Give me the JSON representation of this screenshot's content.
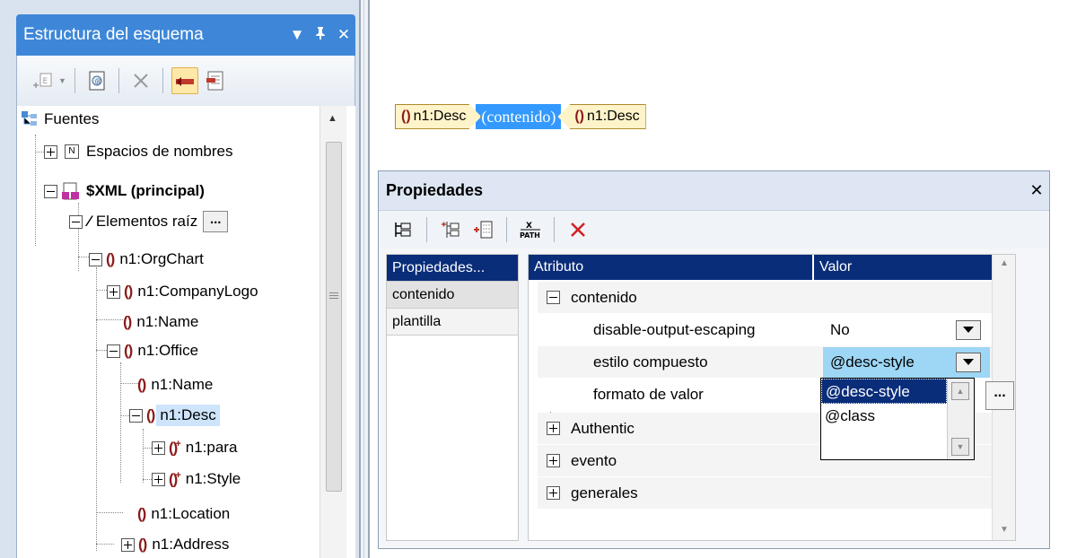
{
  "schema_panel": {
    "title": "Estructura del esquema",
    "title_buttons": [
      "▼",
      "⊥",
      "✕"
    ],
    "tree": {
      "fuentes": "Fuentes",
      "namespaces": "Espacios de nombres",
      "xml_principal": "$XML (principal)",
      "root_elements": "Elementos raíz",
      "root_dots": "...",
      "orgchart": "n1:OrgChart",
      "companylogo": "n1:CompanyLogo",
      "name1": "n1:Name",
      "office": "n1:Office",
      "name2": "n1:Name",
      "desc": "n1:Desc",
      "para": "n1:para",
      "style": "n1:Style",
      "location": "n1:Location",
      "address": "n1:Address"
    }
  },
  "design_view": {
    "tag_open": "n1:Desc",
    "tag_content": "(contenido)",
    "tag_close": "n1:Desc"
  },
  "properties": {
    "title": "Propiedades",
    "close": "✕",
    "left_header": "Propiedades...",
    "left_items": [
      "contenido",
      "plantilla"
    ],
    "col_attr": "Atributo",
    "col_value": "Valor",
    "group_contenido": "contenido",
    "rows": {
      "disable_output_escaping": {
        "label": "disable-output-escaping",
        "value": "No"
      },
      "estilo_compuesto": {
        "label": "estilo compuesto",
        "value": "@desc-style"
      },
      "formato_de_valor": {
        "label": "formato de valor"
      }
    },
    "groups": [
      "Authentic",
      "evento",
      "generales"
    ],
    "dropdown_options": [
      "@desc-style",
      "@class"
    ],
    "dots": "..."
  },
  "colors": {
    "accent_title": "#3e87d8",
    "selection_blue": "#0a2d7a",
    "tag_fill": "#fff3c9",
    "content_highlight": "#3399ff"
  }
}
